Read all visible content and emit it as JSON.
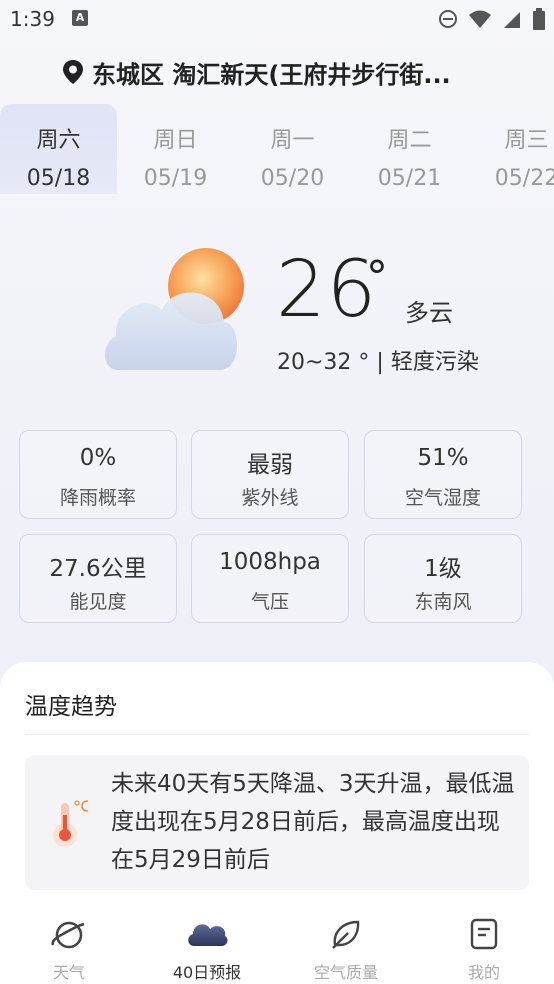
{
  "status": {
    "time": "1:39",
    "indicator": "A"
  },
  "location": {
    "icon": "location-pin-icon",
    "text": "东城区 淘汇新天(王府井步行街..."
  },
  "days": [
    {
      "name": "周六",
      "date": "05/18",
      "active": true
    },
    {
      "name": "周日",
      "date": "05/19",
      "active": false
    },
    {
      "name": "周一",
      "date": "05/20",
      "active": false
    },
    {
      "name": "周二",
      "date": "05/21",
      "active": false
    },
    {
      "name": "周三",
      "date": "05/22",
      "active": false
    }
  ],
  "current": {
    "icon": "partly-cloudy-icon",
    "temp": "26",
    "deg": "°",
    "condition": "多云",
    "range": "20~32 ° | 轻度污染"
  },
  "stats": [
    {
      "value": "0%",
      "label": "降雨概率"
    },
    {
      "value": "最弱",
      "label": "紫外线"
    },
    {
      "value": "51%",
      "label": "空气湿度"
    },
    {
      "value": "27.6公里",
      "label": "能见度"
    },
    {
      "value": "1008hpa",
      "label": "气压"
    },
    {
      "value": "1级",
      "label": "东南风"
    }
  ],
  "trend": {
    "title": "温度趋势",
    "icon": "thermometer-icon",
    "text": "未来40天有5天降温、3天升温，最低温度出现在5月28日前后，最高温度出现在5月29日前后"
  },
  "nav": [
    {
      "label": "天气",
      "icon": "planet-icon",
      "active": false
    },
    {
      "label": "40日预报",
      "icon": "cloud-icon",
      "active": true
    },
    {
      "label": "空气质量",
      "icon": "leaf-icon",
      "active": false
    },
    {
      "label": "我的",
      "icon": "profile-card-icon",
      "active": false
    }
  ],
  "colors": {
    "accent": "#3d4a7a",
    "sun": "#f08a3c",
    "tab_active_bg": "#e2e5f5"
  }
}
